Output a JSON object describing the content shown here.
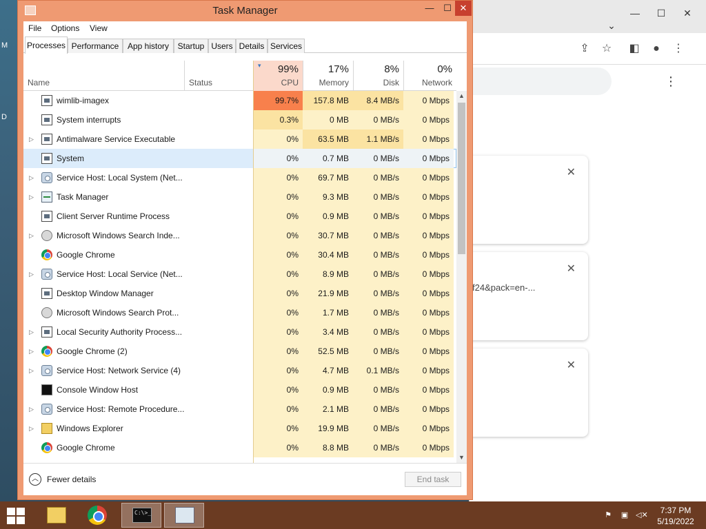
{
  "desktop": {
    "labels": [
      "M",
      "D"
    ]
  },
  "chrome": {
    "card_text": "f24&pack=en-..."
  },
  "task_manager": {
    "title": "Task Manager",
    "menu": [
      "File",
      "Options",
      "View"
    ],
    "tabs": [
      "Processes",
      "Performance",
      "App history",
      "Startup",
      "Users",
      "Details",
      "Services"
    ],
    "active_tab": "Processes",
    "headers": {
      "name": "Name",
      "status": "Status",
      "cpu": {
        "pct": "99%",
        "label": "CPU"
      },
      "memory": {
        "pct": "17%",
        "label": "Memory"
      },
      "disk": {
        "pct": "8%",
        "label": "Disk"
      },
      "network": {
        "pct": "0%",
        "label": "Network"
      }
    },
    "processes": [
      {
        "name": "wimlib-imagex",
        "expandable": false,
        "icon": "generic-app-icon",
        "status": "",
        "cpu": "99.7%",
        "memory": "157.8 MB",
        "disk": "8.4 MB/s",
        "network": "0 Mbps",
        "heat": "cpu-high"
      },
      {
        "name": "System interrupts",
        "expandable": false,
        "icon": "generic-app-icon",
        "status": "",
        "cpu": "0.3%",
        "memory": "0 MB",
        "disk": "0 MB/s",
        "network": "0 Mbps",
        "heat": "cpu-mid"
      },
      {
        "name": "Antimalware Service Executable",
        "expandable": true,
        "icon": "generic-app-icon",
        "status": "",
        "cpu": "0%",
        "memory": "63.5 MB",
        "disk": "1.1 MB/s",
        "network": "0 Mbps",
        "heat": "mem"
      },
      {
        "name": "System",
        "expandable": false,
        "icon": "generic-app-icon",
        "status": "",
        "cpu": "0%",
        "memory": "0.7 MB",
        "disk": "0 MB/s",
        "network": "0 Mbps",
        "heat": "",
        "selected": true
      },
      {
        "name": "Service Host: Local System (Net...",
        "expandable": true,
        "icon": "gear-icon",
        "status": "",
        "cpu": "0%",
        "memory": "69.7 MB",
        "disk": "0 MB/s",
        "network": "0 Mbps",
        "heat": ""
      },
      {
        "name": "Task Manager",
        "expandable": true,
        "icon": "task-manager-icon",
        "status": "",
        "cpu": "0%",
        "memory": "9.3 MB",
        "disk": "0 MB/s",
        "network": "0 Mbps",
        "heat": ""
      },
      {
        "name": "Client Server Runtime Process",
        "expandable": false,
        "icon": "generic-app-icon",
        "status": "",
        "cpu": "0%",
        "memory": "0.9 MB",
        "disk": "0 MB/s",
        "network": "0 Mbps",
        "heat": ""
      },
      {
        "name": "Microsoft Windows Search Inde...",
        "expandable": true,
        "icon": "user-icon",
        "status": "",
        "cpu": "0%",
        "memory": "30.7 MB",
        "disk": "0 MB/s",
        "network": "0 Mbps",
        "heat": ""
      },
      {
        "name": "Google Chrome",
        "expandable": false,
        "icon": "chrome-icon",
        "status": "",
        "cpu": "0%",
        "memory": "30.4 MB",
        "disk": "0 MB/s",
        "network": "0 Mbps",
        "heat": ""
      },
      {
        "name": "Service Host: Local Service (Net...",
        "expandable": true,
        "icon": "gear-icon",
        "status": "",
        "cpu": "0%",
        "memory": "8.9 MB",
        "disk": "0 MB/s",
        "network": "0 Mbps",
        "heat": ""
      },
      {
        "name": "Desktop Window Manager",
        "expandable": false,
        "icon": "generic-app-icon",
        "status": "",
        "cpu": "0%",
        "memory": "21.9 MB",
        "disk": "0 MB/s",
        "network": "0 Mbps",
        "heat": ""
      },
      {
        "name": "Microsoft Windows Search Prot...",
        "expandable": false,
        "icon": "user-icon",
        "status": "",
        "cpu": "0%",
        "memory": "1.7 MB",
        "disk": "0 MB/s",
        "network": "0 Mbps",
        "heat": ""
      },
      {
        "name": "Local Security Authority Process...",
        "expandable": true,
        "icon": "generic-app-icon",
        "status": "",
        "cpu": "0%",
        "memory": "3.4 MB",
        "disk": "0 MB/s",
        "network": "0 Mbps",
        "heat": ""
      },
      {
        "name": "Google Chrome (2)",
        "expandable": true,
        "icon": "chrome-icon",
        "status": "",
        "cpu": "0%",
        "memory": "52.5 MB",
        "disk": "0 MB/s",
        "network": "0 Mbps",
        "heat": ""
      },
      {
        "name": "Service Host: Network Service (4)",
        "expandable": true,
        "icon": "gear-icon",
        "status": "",
        "cpu": "0%",
        "memory": "4.7 MB",
        "disk": "0.1 MB/s",
        "network": "0 Mbps",
        "heat": ""
      },
      {
        "name": "Console Window Host",
        "expandable": false,
        "icon": "console-icon",
        "status": "",
        "cpu": "0%",
        "memory": "0.9 MB",
        "disk": "0 MB/s",
        "network": "0 Mbps",
        "heat": ""
      },
      {
        "name": "Service Host: Remote Procedure...",
        "expandable": true,
        "icon": "gear-icon",
        "status": "",
        "cpu": "0%",
        "memory": "2.1 MB",
        "disk": "0 MB/s",
        "network": "0 Mbps",
        "heat": ""
      },
      {
        "name": "Windows Explorer",
        "expandable": true,
        "icon": "explorer-icon",
        "status": "",
        "cpu": "0%",
        "memory": "19.9 MB",
        "disk": "0 MB/s",
        "network": "0 Mbps",
        "heat": ""
      },
      {
        "name": "Google Chrome",
        "expandable": false,
        "icon": "chrome-icon",
        "status": "",
        "cpu": "0%",
        "memory": "8.8 MB",
        "disk": "0 MB/s",
        "network": "0 Mbps",
        "heat": ""
      }
    ],
    "footer": {
      "fewer_details": "Fewer details",
      "end_task": "End task"
    }
  },
  "taskbar": {
    "apps": [
      "file-explorer-icon",
      "chrome-icon",
      "command-prompt-icon",
      "task-manager-icon"
    ],
    "console_glyph": "C:\\>_",
    "clock": {
      "time": "7:37 PM",
      "date": "5/19/2022"
    }
  },
  "colors": {
    "titlebar_accent": "#ef9a72",
    "cpu_high": "#f8804c",
    "heat_mid": "#fbe3a2",
    "heat_low": "#fdf1c8",
    "selection": "#dcecfb",
    "taskbar": "#6b3b22"
  }
}
